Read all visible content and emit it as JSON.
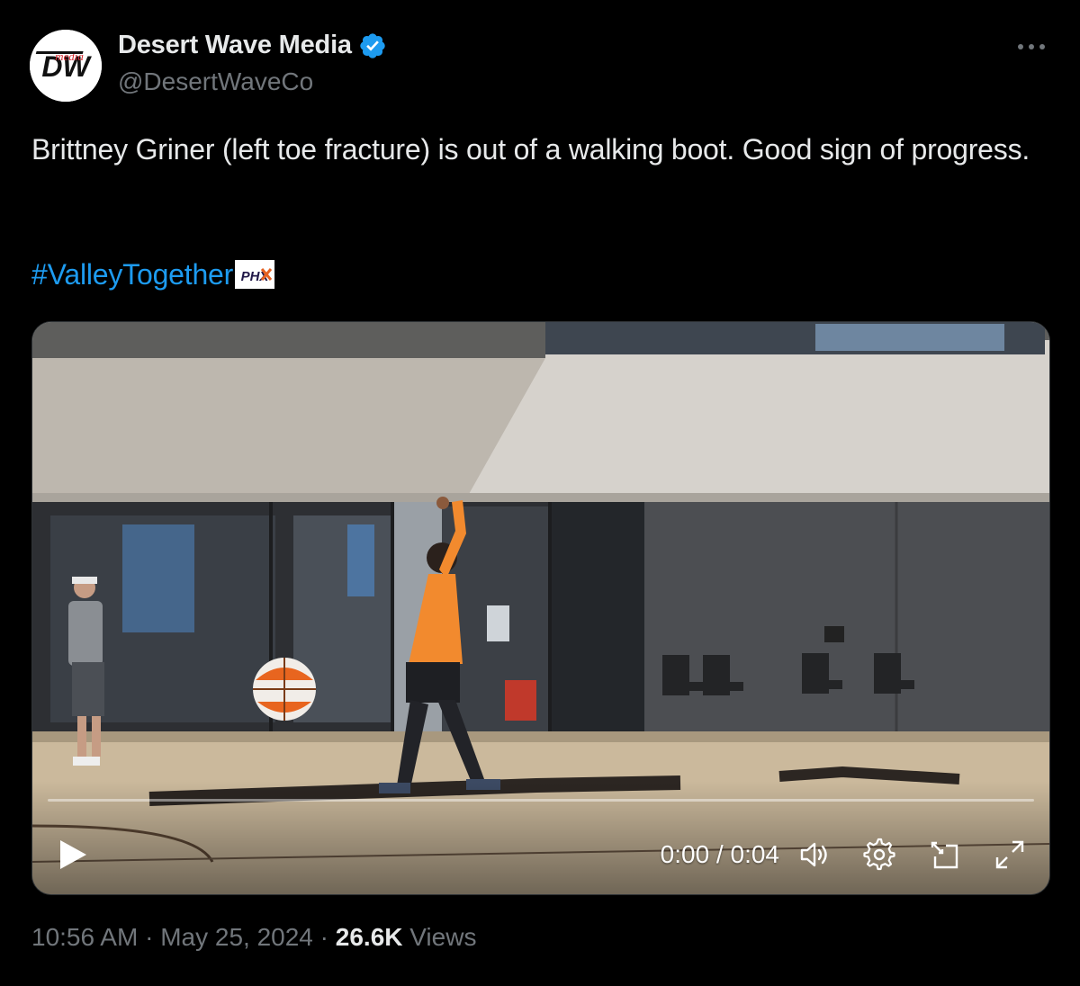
{
  "tweet": {
    "author": {
      "display_name": "Desert Wave Media",
      "handle": "@DesertWaveCo",
      "avatar_text": "DW",
      "avatar_script": "media",
      "verified": true
    },
    "text_line": "Brittney Griner (left toe fracture) is out of a walking boot. Good sign of progress.",
    "hashtag": "#ValleyTogether",
    "hashtag_emoji": "PHX",
    "video": {
      "current_time": "0:00",
      "duration": "0:04",
      "time_display": "0:00 / 0:04",
      "progress_fraction": 0.0
    },
    "meta": {
      "time": "10:56 AM",
      "separator": "·",
      "date": "May 25, 2024",
      "views_count": "26.6K",
      "views_label": "Views"
    }
  },
  "icons": {
    "more": "more-horizontal-icon",
    "verified": "verified-badge-icon",
    "play": "play-icon",
    "volume": "volume-icon",
    "settings": "settings-gear-icon",
    "pip": "picture-in-picture-icon",
    "fullscreen": "fullscreen-icon"
  },
  "colors": {
    "background": "#000000",
    "text_primary": "#e7e9ea",
    "text_secondary": "#71767b",
    "link": "#1d9bf0",
    "verified": "#1d9bf0",
    "jersey": "#f28a2e"
  }
}
